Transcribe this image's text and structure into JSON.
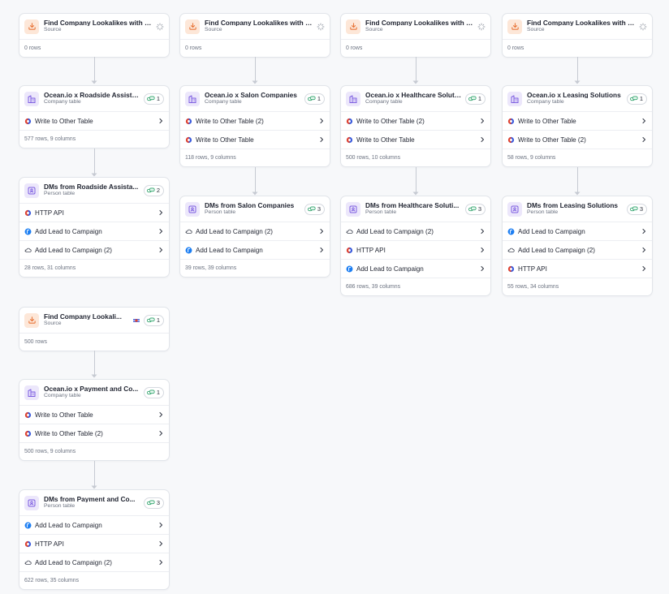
{
  "colors": {
    "source_icon": "#e8763a",
    "table_icon": "#7c5ce0",
    "clay_red": "#e4432d",
    "clay_blue": "#3b5bdb",
    "lemlist_blue": "#1c7ef2",
    "border": "#e2e5ea",
    "muted_text": "#6b7280"
  },
  "icons": {
    "source": "download-tray-icon",
    "company_table": "building-icon",
    "person_table": "person-card-icon",
    "badge": "link-chain-icon",
    "write_table": "clay-logo-icon",
    "http_api": "clay-logo-icon",
    "lemlist": "lemlist-logo-icon",
    "smartlead": "cloud-send-icon",
    "chevron": "chevron-right-icon",
    "loading": "spinner-icon",
    "status": "flag-icon"
  },
  "column1": {
    "source": {
      "title": "Find Company Lookalikes with O...",
      "subtitle": "Source",
      "footer": "0 rows"
    },
    "company": {
      "title": "Ocean.io x Roadside Assista...",
      "subtitle": "Company table",
      "badge": "1",
      "actions": [
        {
          "label": "Write to Other Table"
        }
      ],
      "footer": "577 rows, 9 columns"
    },
    "person": {
      "title": "DMs from Roadside Assista...",
      "subtitle": "Person table",
      "badge": "2",
      "actions": [
        {
          "label": "HTTP API"
        },
        {
          "label": "Add Lead to Campaign"
        },
        {
          "label": "Add Lead to Campaign (2)"
        }
      ],
      "footer": "28 rows, 31 columns"
    }
  },
  "column2": {
    "source": {
      "title": "Find Company Lookalikes with O...",
      "subtitle": "Source",
      "footer": "0 rows"
    },
    "company": {
      "title": "Ocean.io x Salon Companies",
      "subtitle": "Company table",
      "badge": "1",
      "actions": [
        {
          "label": "Write to Other Table (2)"
        },
        {
          "label": "Write to Other Table"
        }
      ],
      "footer": "118 rows, 9 columns"
    },
    "person": {
      "title": "DMs from Salon Companies",
      "subtitle": "Person table",
      "badge": "3",
      "actions": [
        {
          "label": "Add Lead to Campaign (2)"
        },
        {
          "label": "Add Lead to Campaign"
        }
      ],
      "footer": "39 rows, 39 columns"
    }
  },
  "column3": {
    "source": {
      "title": "Find Company Lookalikes with O...",
      "subtitle": "Source",
      "footer": "0 rows"
    },
    "company": {
      "title": "Ocean.io x Healthcare Soluti...",
      "subtitle": "Company table",
      "badge": "1",
      "actions": [
        {
          "label": "Write to Other Table (2)"
        },
        {
          "label": "Write to Other Table"
        }
      ],
      "footer": "500 rows, 10 columns"
    },
    "person": {
      "title": "DMs from Healthcare Soluti...",
      "subtitle": "Person table",
      "badge": "3",
      "actions": [
        {
          "label": "Add Lead to Campaign (2)"
        },
        {
          "label": "HTTP API"
        },
        {
          "label": "Add Lead to Campaign"
        }
      ],
      "footer": "686 rows, 39 columns"
    }
  },
  "column4": {
    "source": {
      "title": "Find Company Lookalikes with O...",
      "subtitle": "Source",
      "footer": "0 rows"
    },
    "company": {
      "title": "Ocean.io x Leasing Solutions",
      "subtitle": "Company table",
      "badge": "1",
      "actions": [
        {
          "label": "Write to Other Table"
        },
        {
          "label": "Write to Other Table (2)"
        }
      ],
      "footer": "58 rows, 9 columns"
    },
    "person": {
      "title": "DMs from Leasing Solutions",
      "subtitle": "Person table",
      "badge": "3",
      "actions": [
        {
          "label": "Add Lead to Campaign"
        },
        {
          "label": "Add Lead to Campaign (2)"
        },
        {
          "label": "HTTP API"
        }
      ],
      "footer": "55 rows, 34 columns"
    }
  },
  "column5": {
    "source": {
      "title": "Find Company Lookali...",
      "subtitle": "Source",
      "badge": "1",
      "footer": "500 rows"
    },
    "company": {
      "title": "Ocean.io x Payment and Co...",
      "subtitle": "Company table",
      "badge": "1",
      "actions": [
        {
          "label": "Write to Other Table"
        },
        {
          "label": "Write to Other Table (2)"
        }
      ],
      "footer": "500 rows, 9 columns"
    },
    "person": {
      "title": "DMs from Payment and Co...",
      "subtitle": "Person table",
      "badge": "3",
      "actions": [
        {
          "label": "Add Lead to Campaign"
        },
        {
          "label": "HTTP API"
        },
        {
          "label": "Add Lead to Campaign (2)"
        }
      ],
      "footer": "622 rows, 35 columns"
    }
  }
}
